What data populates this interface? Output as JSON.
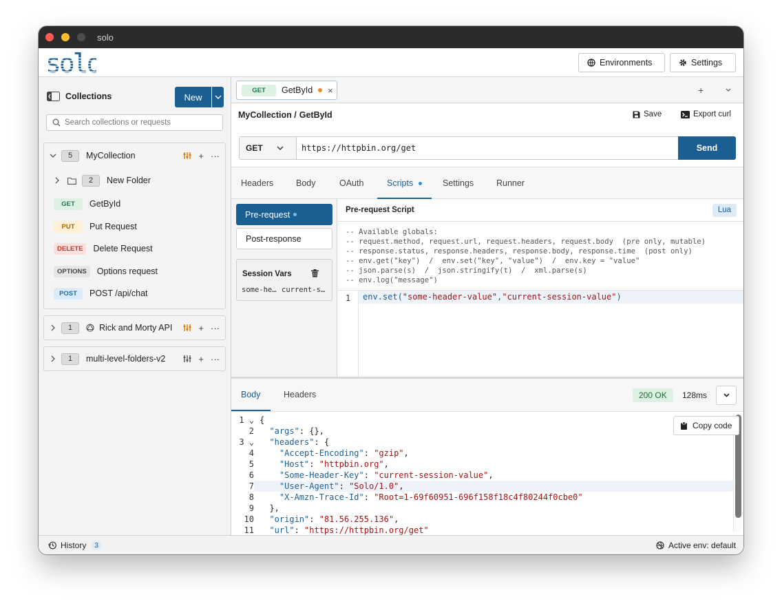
{
  "window": {
    "title": "solo"
  },
  "header": {
    "logo_text": "solo",
    "environments_label": "Environments",
    "settings_label": "Settings"
  },
  "sidebar": {
    "title": "Collections",
    "new_label": "New",
    "search_placeholder": "Search collections or requests",
    "collections": [
      {
        "count": "5",
        "name": "MyCollection",
        "expanded": true,
        "folders": [
          {
            "count": "2",
            "name": "New Folder"
          }
        ],
        "requests": [
          {
            "method": "GET",
            "name": "GetById"
          },
          {
            "method": "PUT",
            "name": "Put Request"
          },
          {
            "method": "DELETE",
            "name": "Delete Request"
          },
          {
            "method": "OPTIONS",
            "name": "Options request"
          },
          {
            "method": "POST",
            "name": "POST /api/chat"
          }
        ]
      },
      {
        "count": "1",
        "name": "Rick and Morty API",
        "expanded": false
      },
      {
        "count": "1",
        "name": "multi-level-folders-v2",
        "expanded": false
      }
    ]
  },
  "tab": {
    "method": "GET",
    "name": "GetById"
  },
  "breadcrumb": {
    "collection": "MyCollection /",
    "request": "GetById"
  },
  "toolbar": {
    "save_label": "Save",
    "export_label": "Export curl"
  },
  "request": {
    "method": "GET",
    "url": "https://httpbin.org/get",
    "send_label": "Send"
  },
  "subtabs": [
    "Headers",
    "Body",
    "OAuth",
    "Scripts",
    "Settings",
    "Runner"
  ],
  "scripts": {
    "pre_request_label": "Pre-request",
    "post_response_label": "Post-response",
    "session_vars_label": "Session Vars",
    "session_var_key": "some-he…",
    "session_var_value": "current-s…",
    "panel_title": "Pre-request Script",
    "language": "Lua",
    "globals": [
      "-- Available globals:",
      "-- request.method, request.url, request.headers, request.body  (pre only, mutable)",
      "-- response.status, response.headers, response.body, response.time  (post only)",
      "-- env.get(\"key\")  /  env.set(\"key\", \"value\")  /  env.key = \"value\"",
      "-- json.parse(s)  /  json.stringify(t)  /  xml.parse(s)",
      "-- env.log(\"message\")"
    ],
    "code_line_number": "1",
    "code": {
      "fn": "env.set(",
      "arg1": "\"some-header-value\"",
      "sep": ",",
      "arg2": "\"current-session-value\"",
      "close": ")"
    }
  },
  "response": {
    "tabs": [
      "Body",
      "Headers"
    ],
    "status": "200 OK",
    "time": "128ms",
    "copy_label": "Copy code",
    "line_numbers": [
      "1",
      "2",
      "3",
      "4",
      "5",
      "6",
      "7",
      "8",
      "9",
      "10",
      "11"
    ],
    "lines": [
      "{",
      "  \"args\": {},",
      "  \"headers\": {",
      "    \"Accept-Encoding\": \"gzip\",",
      "    \"Host\": \"httpbin.org\",",
      "    \"Some-Header-Key\": \"current-session-value\",",
      "    \"User-Agent\": \"Solo/1.0\",",
      "    \"X-Amzn-Trace-Id\": \"Root=1-69f60951-696f158f18c4f80244f0cbe0\"",
      "  },",
      "  \"origin\": \"81.56.255.136\",",
      "  \"url\": \"https://httpbin.org/get\""
    ]
  },
  "status_bar": {
    "history_label": "History",
    "history_count": "3",
    "active_env": "Active env: default"
  },
  "colors": {
    "primary": "#1b5e91",
    "get": "#1f7a4d",
    "put": "#a86a00",
    "delete": "#c0392b",
    "post": "#1b6fb0",
    "options": "#444444"
  }
}
